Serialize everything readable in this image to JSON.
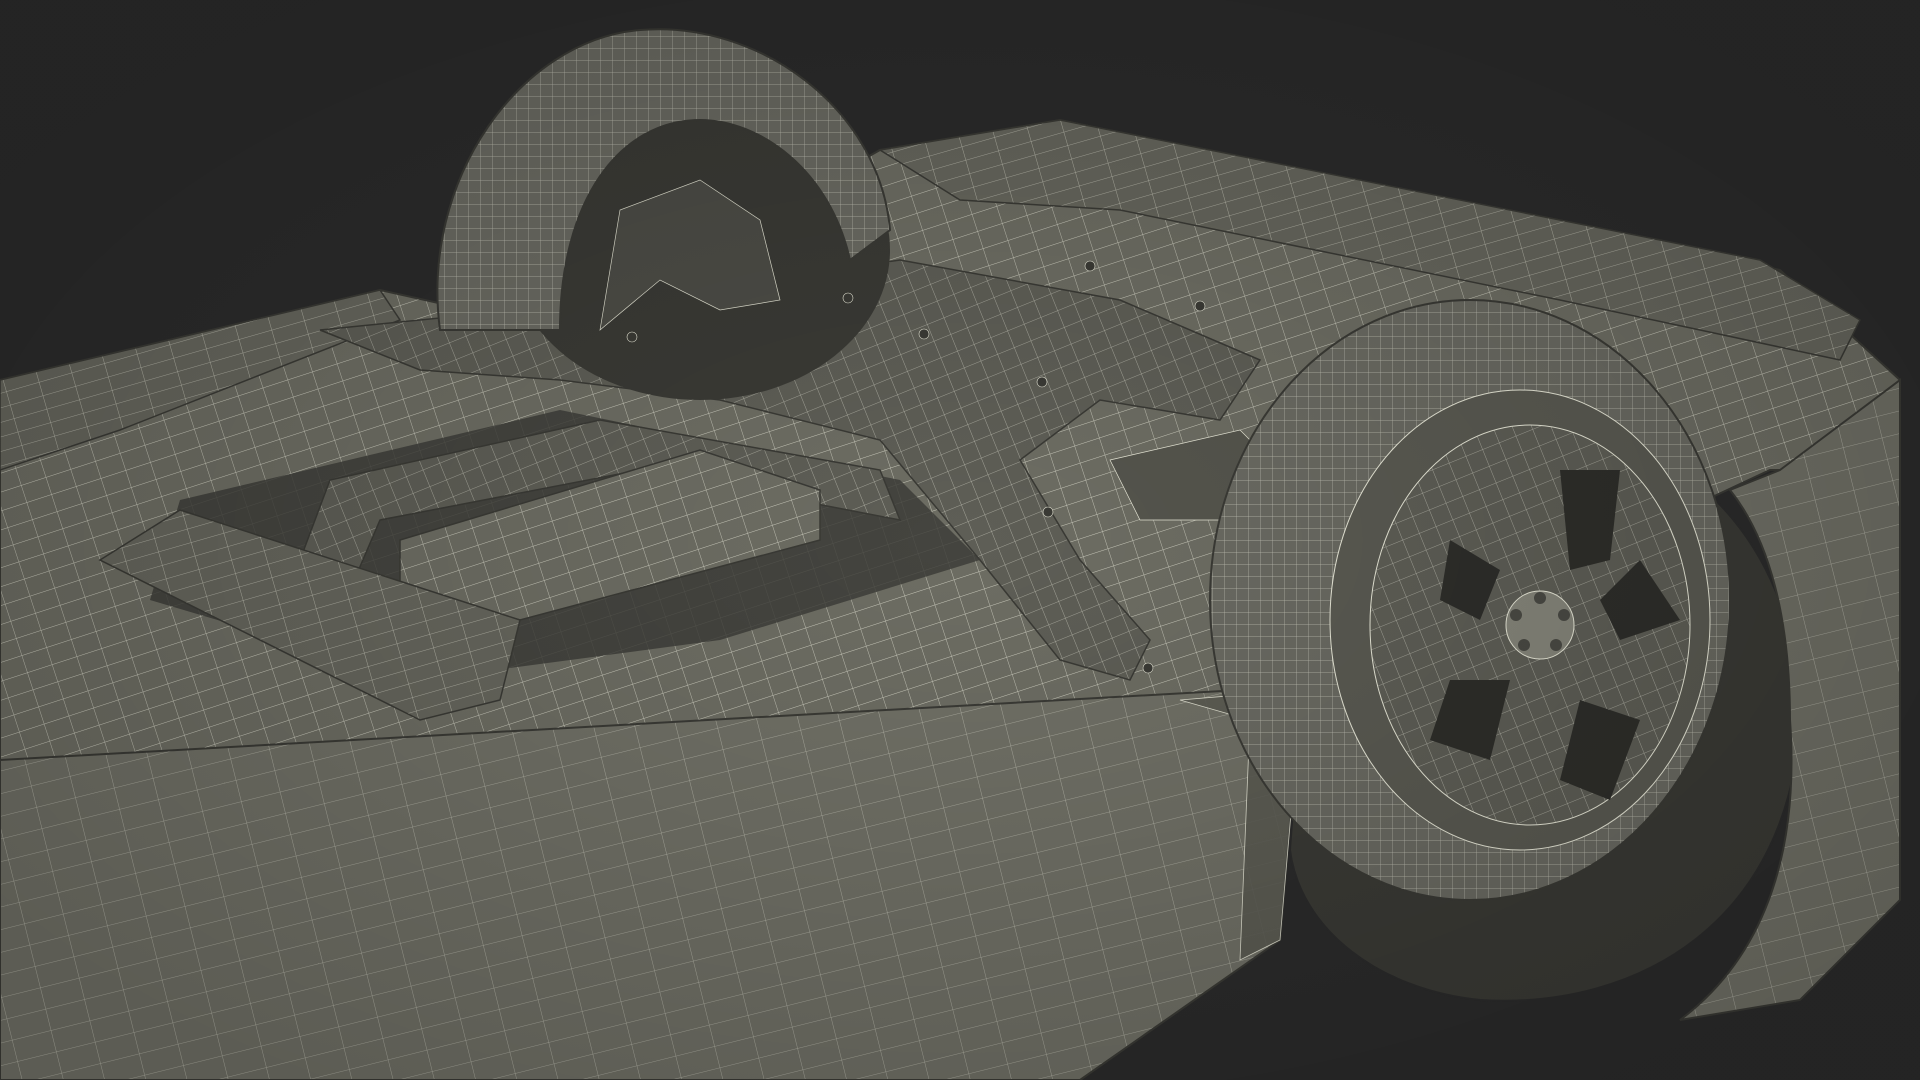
{
  "scene": {
    "subject": "car-underbody-wireframe",
    "background_color": "#2b2b2b",
    "surface_color": "#6d6d63",
    "surface_shadow_color": "#4a4a44",
    "surface_light_color": "#85857a",
    "wire_color": "#e8e8d8",
    "tire_color": "#6a6a62",
    "rim_color": "#77776c"
  }
}
